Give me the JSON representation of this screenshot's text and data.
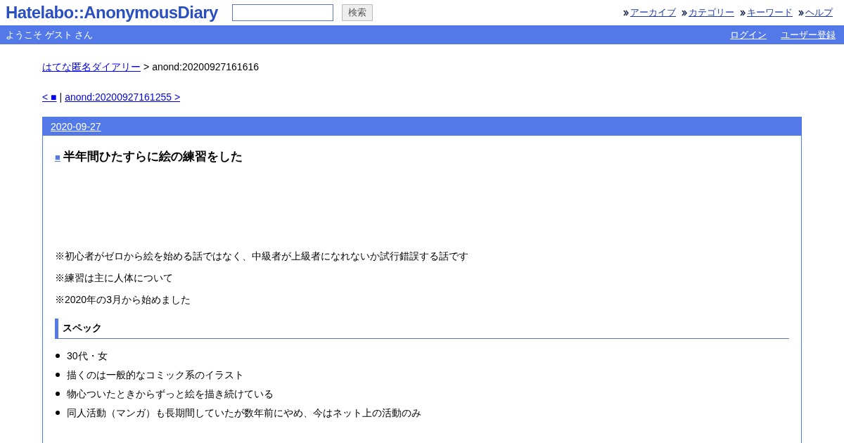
{
  "header": {
    "logo": "Hatelabo::AnonymousDiary",
    "search": {
      "button": "検索"
    },
    "nav": [
      "アーカイブ",
      "カテゴリー",
      "キーワード",
      "ヘルプ"
    ]
  },
  "user_bar": {
    "welcome": "ようこそ ゲスト さん",
    "links": [
      "ログイン",
      "ユーザー登録"
    ]
  },
  "breadcrumb": {
    "home": "はてな匿名ダイアリー",
    "separator": ">",
    "current": "anond:20200927161616"
  },
  "pager": {
    "prev": "< ■",
    "separator": "|",
    "next": "anond:20200927161255 >"
  },
  "entry": {
    "date": "2020-09-27",
    "title_mark": "■",
    "title": "半年間ひたすらに絵の練習をした",
    "notes": [
      "※初心者がゼロから絵を始める話ではなく、中級者が上級者になれないか試行錯誤する話です",
      "※練習は主に人体について",
      "※2020年の3月から始めました"
    ],
    "section": "スペック",
    "bullets": [
      "30代・女",
      "描くのは一般的なコミック系のイラスト",
      "物心ついたときからずっと絵を描き続けている",
      "同人活動（マンガ）も長期間していたが数年前にやめ、今はネット上の活動のみ"
    ]
  }
}
